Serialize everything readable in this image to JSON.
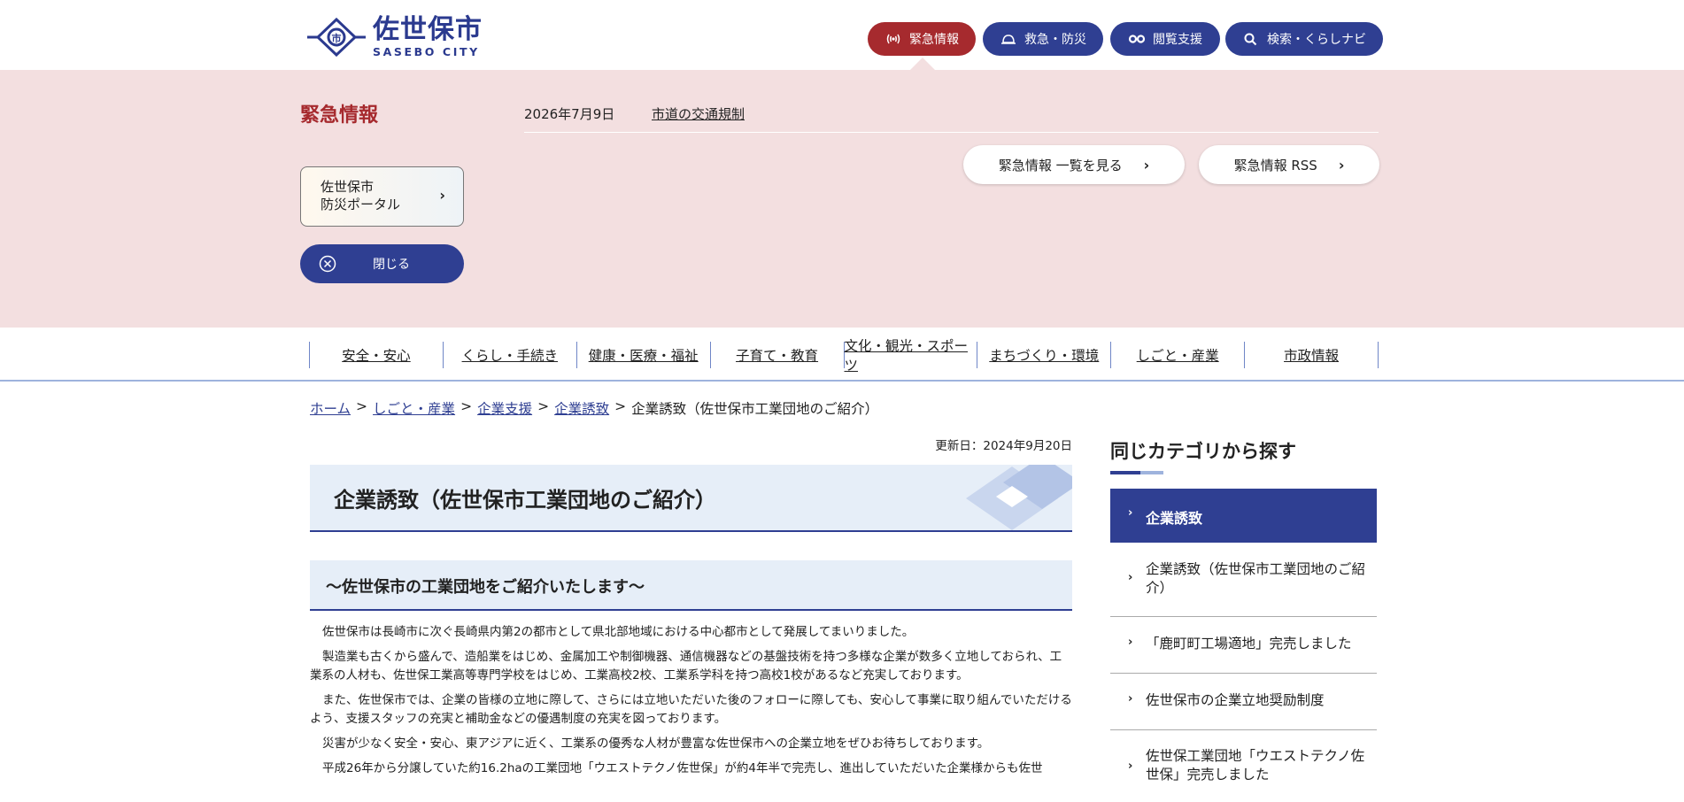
{
  "header": {
    "logo_ja": "佐世保市",
    "logo_en": "SASEBO CITY",
    "buttons": {
      "emergency": "緊急情報",
      "rescue": "救急・防災",
      "browse": "閲覧支援",
      "search": "検索・くらしナビ"
    }
  },
  "emergency": {
    "title": "緊急情報",
    "items": [
      {
        "date": "2026年7月9日",
        "label": "市道の交通規制"
      }
    ],
    "list_button": "緊急情報 一覧を見る",
    "rss_button": "緊急情報 RSS",
    "portal_line1": "佐世保市",
    "portal_line2": "防災ポータル",
    "close_label": "閉じる"
  },
  "gnav": {
    "items": [
      "安全・安心",
      "くらし・手続き",
      "健康・医療・福祉",
      "子育て・教育",
      "文化・観光・スポーツ",
      "まちづくり・環境",
      "しごと・産業",
      "市政情報"
    ]
  },
  "breadcrumb": {
    "items": [
      "ホーム",
      "しごと・産業",
      "企業支援",
      "企業誘致"
    ],
    "separator": ">",
    "current": "企業誘致（佐世保市工業団地のご紹介）"
  },
  "article": {
    "updated": "更新日：2024年9月20日",
    "title": "企業誘致（佐世保市工業団地のご紹介）",
    "subtitle": "～佐世保市の工業団地をご紹介いたします～",
    "paragraphs": [
      "佐世保市は長崎市に次ぐ長崎県内第2の都市として県北部地域における中心都市として発展してまいりました。",
      "製造業も古くから盛んで、造船業をはじめ、金属加工や制御機器、通信機器などの基盤技術を持つ多様な企業が数多く立地しておられ、工業系の人材も、佐世保工業高等専門学校をはじめ、工業高校2校、工業系学科を持つ高校1校があるなど充実しております。",
      "また、佐世保市では、企業の皆様の立地に際して、さらには立地いただいた後のフォローに際しても、安心して事業に取り組んでいただけるよう、支援スタッフの充実と補助金などの優遇制度の充実を図っております。",
      "災害が少なく安全・安心、東アジアに近く、工業系の優秀な人材が豊富な佐世保市への企業立地をぜひお待ちしております。",
      "平成26年から分譲していた約16.2haの工業団地「ウエストテクノ佐世保」が約4年半で完売し、進出していただいた企業様からも佐世"
    ]
  },
  "side": {
    "heading": "同じカテゴリから探す",
    "active": "企業誘致",
    "items": [
      "企業誘致（佐世保市工業団地のご紹介）",
      "「鹿町町工場適地」完売しました",
      "佐世保市の企業立地奨励制度",
      "佐世保工業団地「ウエストテクノ佐世保」完売しました"
    ]
  }
}
